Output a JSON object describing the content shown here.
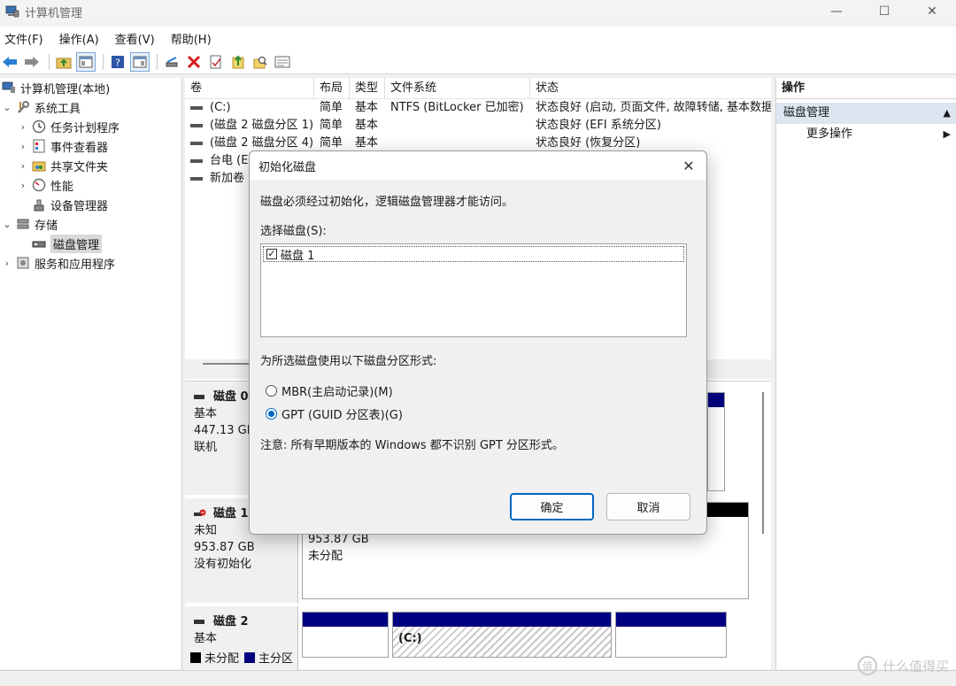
{
  "window": {
    "title": "计算机管理",
    "minimize": "—",
    "maximize": "☐",
    "close": "✕"
  },
  "menu": [
    "文件(F)",
    "操作(A)",
    "查看(V)",
    "帮助(H)"
  ],
  "tree": {
    "root": "计算机管理(本地)",
    "system_tools": "系统工具",
    "task_scheduler": "任务计划程序",
    "event_viewer": "事件查看器",
    "shared_folders": "共享文件夹",
    "performance": "性能",
    "device_manager": "设备管理器",
    "storage": "存储",
    "disk_management": "磁盘管理",
    "services": "服务和应用程序"
  },
  "list": {
    "headers": [
      "卷",
      "布局",
      "类型",
      "文件系统",
      "状态"
    ],
    "rows": [
      [
        "(C:)",
        "简单",
        "基本",
        "NTFS (BitLocker 已加密)",
        "状态良好 (启动, 页面文件, 故障转储, 基本数据"
      ],
      [
        "(磁盘 2 磁盘分区 1)",
        "简单",
        "基本",
        "",
        "状态良好 (EFI 系统分区)"
      ],
      [
        "(磁盘 2 磁盘分区 4)",
        "简单",
        "基本",
        "",
        "状态良好 (恢复分区)"
      ],
      [
        "台电 (E:",
        "",
        "",
        "",
        ""
      ],
      [
        "新加卷 (",
        "",
        "",
        "",
        ""
      ]
    ]
  },
  "disks": {
    "disk0": {
      "name": "磁盘 0",
      "type": "基本",
      "size": "447.13 GB",
      "status": "联机"
    },
    "disk1": {
      "name": "磁盘 1",
      "type": "未知",
      "size": "953.87 GB",
      "status": "没有初始化",
      "part_size": "953.87 GB",
      "part_status": "未分配"
    },
    "disk2": {
      "name": "磁盘 2",
      "type": "基本",
      "part_label": "(C:)"
    }
  },
  "legend": {
    "unallocated": "未分配",
    "primary": "主分区"
  },
  "actions": {
    "header": "操作",
    "section": "磁盘管理",
    "more": "更多操作"
  },
  "dialog": {
    "title": "初始化磁盘",
    "message": "磁盘必须经过初始化，逻辑磁盘管理器才能访问。",
    "select_label": "选择磁盘(S):",
    "disk_item": "磁盘 1",
    "style_label": "为所选磁盘使用以下磁盘分区形式:",
    "mbr": "MBR(主启动记录)(M)",
    "gpt": "GPT (GUID 分区表)(G)",
    "note": "注意: 所有早期版本的 Windows 都不识别 GPT 分区形式。",
    "ok": "确定",
    "cancel": "取消",
    "selected_style": "GPT"
  },
  "watermark": "什么值得买",
  "colors": {
    "primary_partition": "#000080",
    "unallocated": "#000000",
    "accent": "#0067c0"
  }
}
